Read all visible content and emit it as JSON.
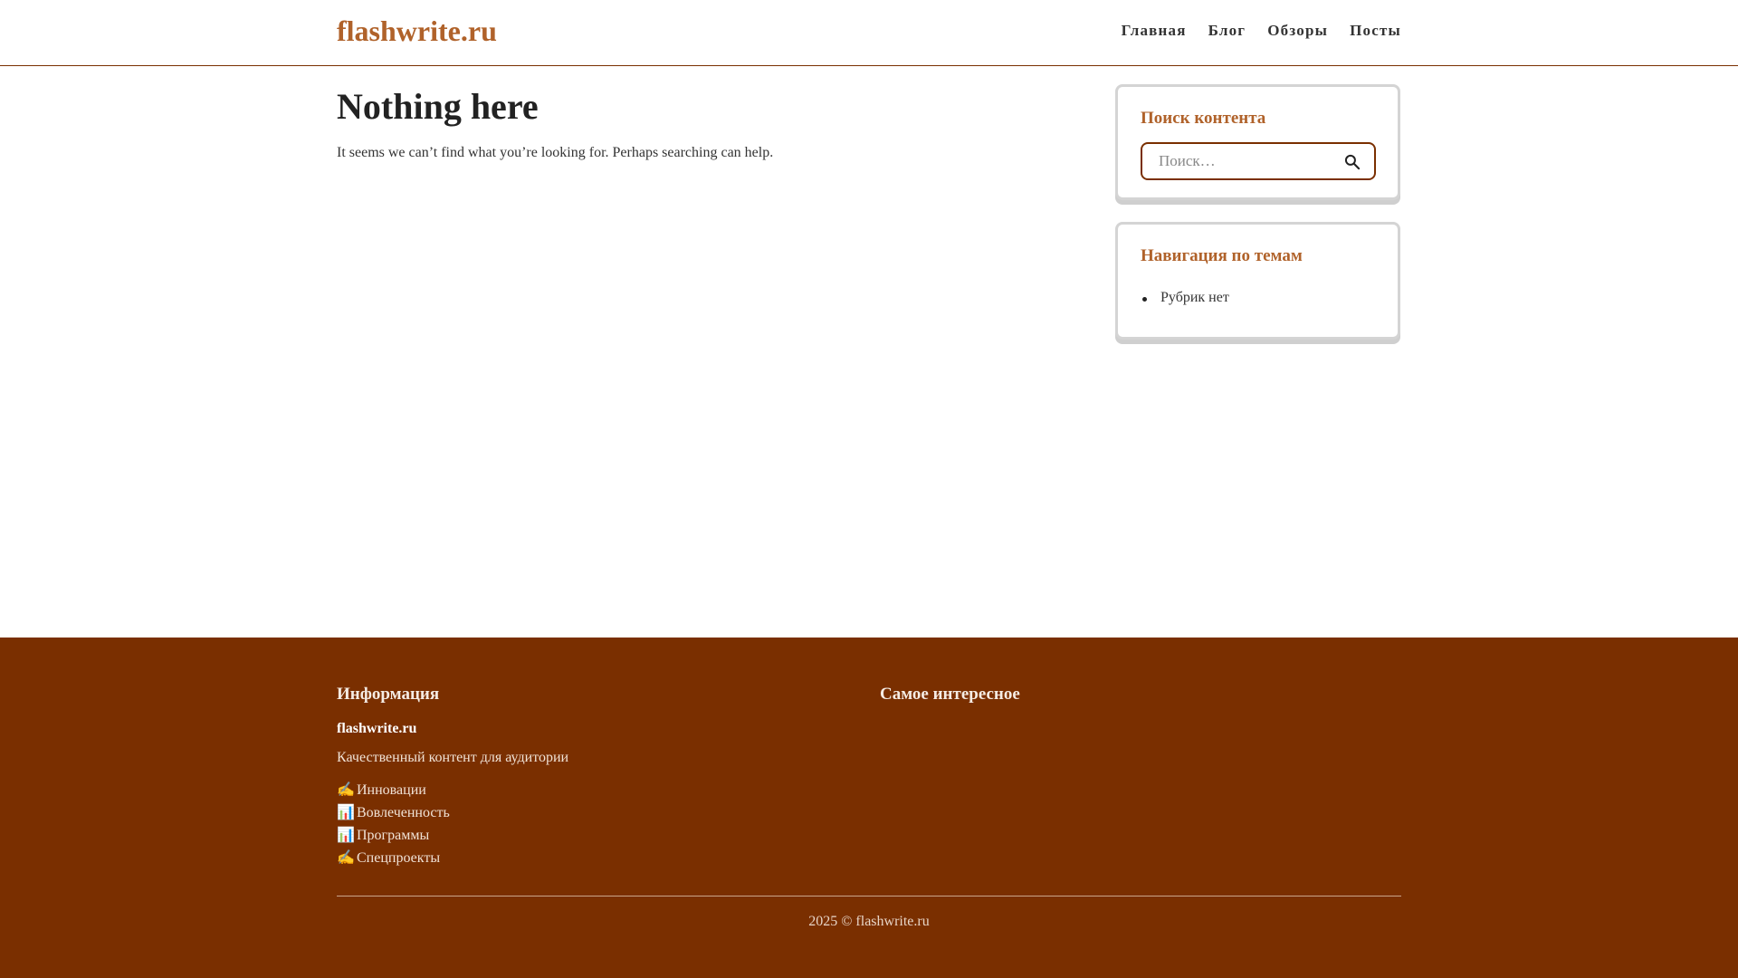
{
  "header": {
    "logo": "flashwrite.ru",
    "nav": [
      "Главная",
      "Блог",
      "Обзоры",
      "Посты"
    ]
  },
  "main": {
    "title": "Nothing here",
    "message": "It seems we can’t find what you’re looking for. Perhaps searching can help."
  },
  "sidebar": {
    "search": {
      "title": "Поиск контента",
      "placeholder": "Поиск…",
      "icon": "search-icon"
    },
    "categories": {
      "title": "Навигация по темам",
      "items": [
        "Рубрик нет"
      ]
    }
  },
  "footer": {
    "col1": {
      "heading": "Информация",
      "site": "flashwrite.ru",
      "description": "Качественный контент для аудитории",
      "links": [
        {
          "icon": "✍️",
          "label": "Инновации"
        },
        {
          "icon": "📊",
          "label": "Вовлеченность"
        },
        {
          "icon": "📊",
          "label": "Программы"
        },
        {
          "icon": "✍️",
          "label": "Спецпроекты"
        }
      ]
    },
    "col2": {
      "heading": "Самое интересное"
    },
    "copyright": "2025 © flashwrite.ru"
  },
  "colors": {
    "accent": "#b0622a",
    "footer_bg": "#7a2f00"
  }
}
